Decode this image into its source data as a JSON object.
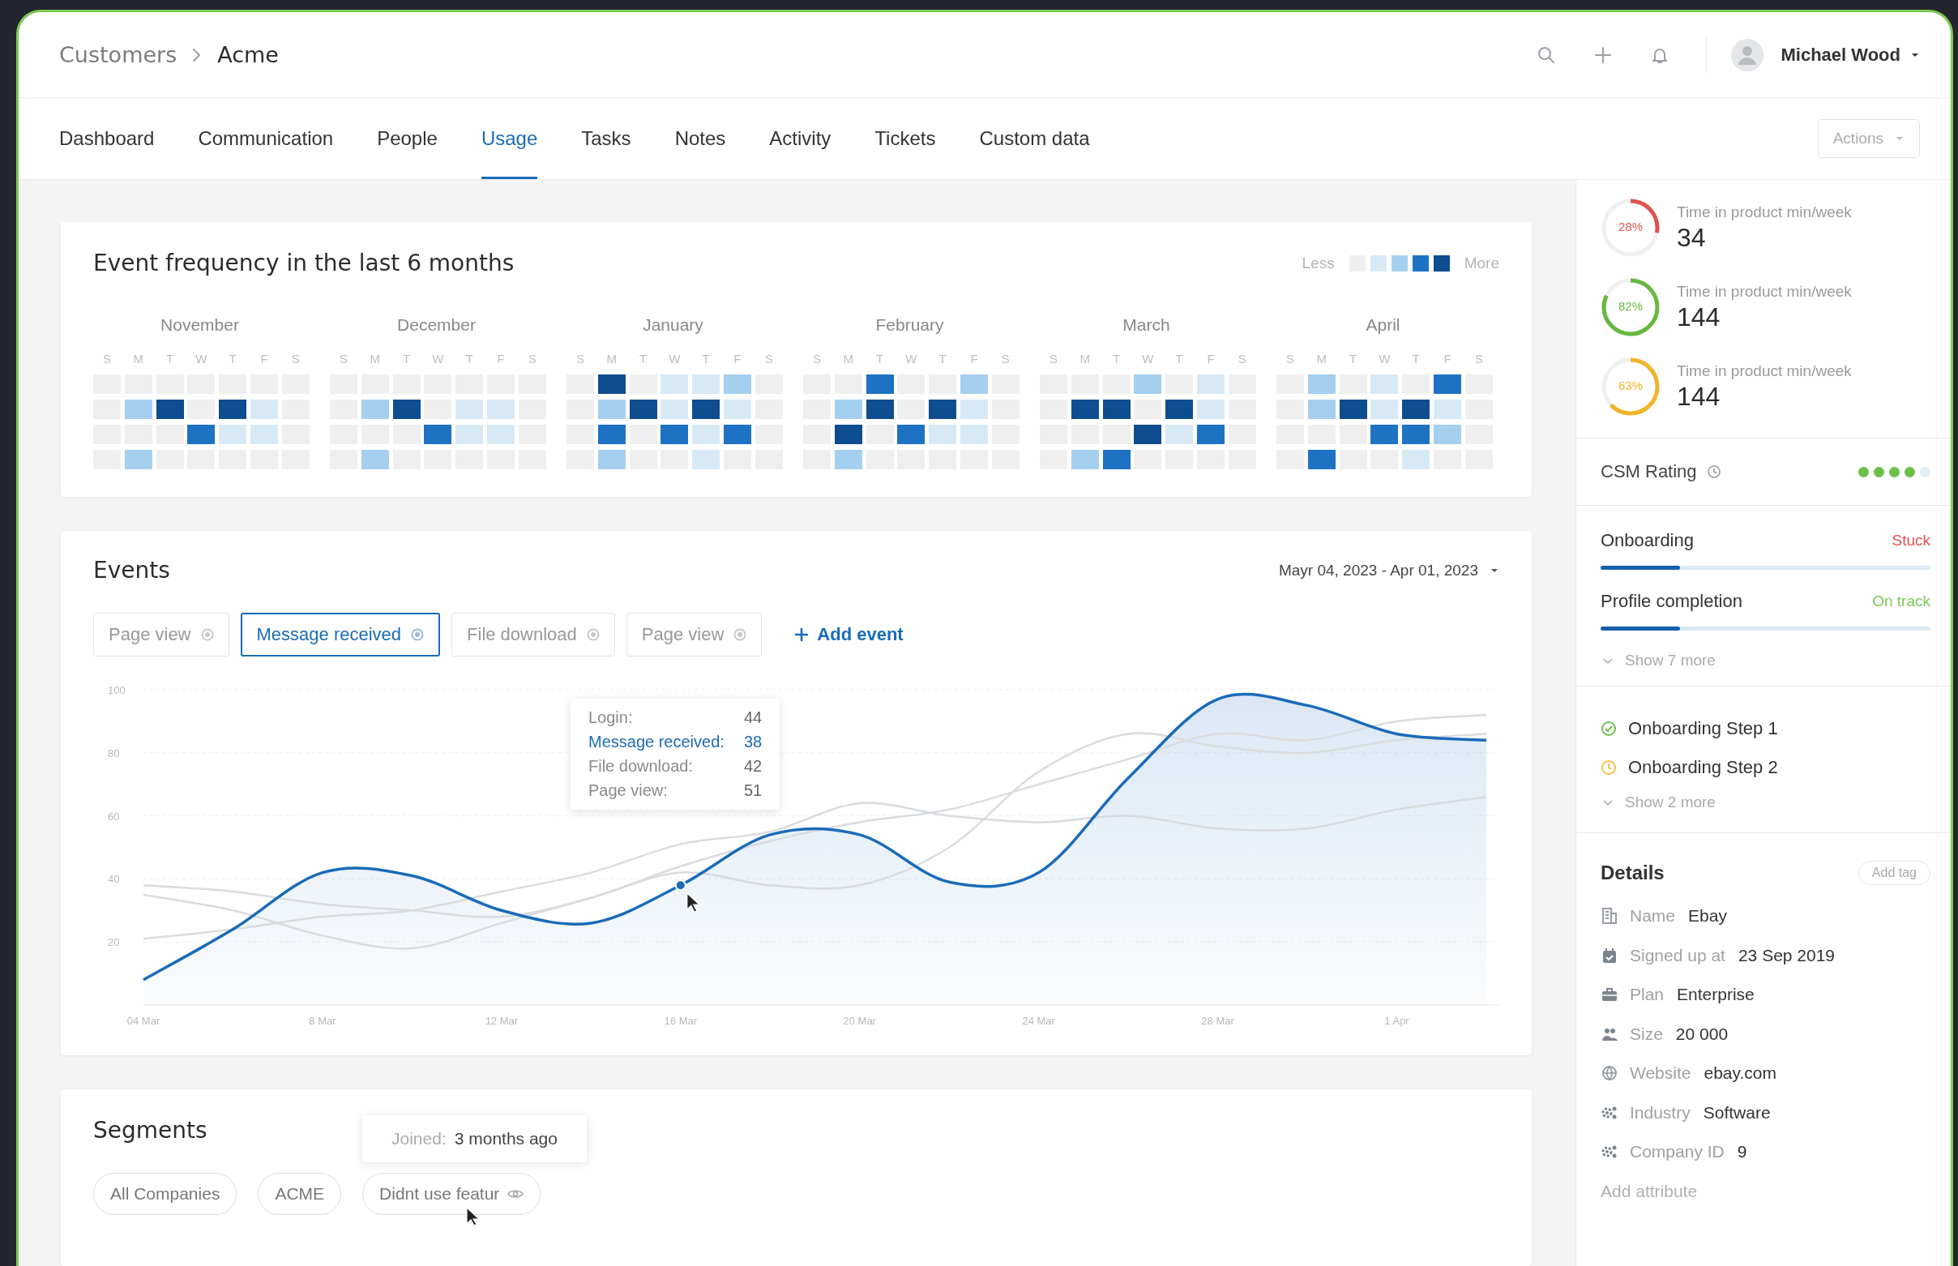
{
  "breadcrumb": [
    "Customers",
    "Acme"
  ],
  "user": {
    "name": "Michael Wood"
  },
  "tabs": [
    {
      "label": "Dashboard",
      "selected": false
    },
    {
      "label": "Communication",
      "selected": false
    },
    {
      "label": "People",
      "selected": false
    },
    {
      "label": "Usage",
      "selected": true
    },
    {
      "label": "Tasks",
      "selected": false
    },
    {
      "label": "Notes",
      "selected": false
    },
    {
      "label": "Activity",
      "selected": false
    },
    {
      "label": "Tickets",
      "selected": false
    },
    {
      "label": "Custom data",
      "selected": false
    }
  ],
  "actions_button": "Actions",
  "heatmap": {
    "title": "Event frequency in the last 6 months",
    "legend": {
      "less": "Less",
      "more": "More"
    },
    "months": [
      {
        "name": "November",
        "weekdays": [
          "S",
          "M",
          "T",
          "W",
          "T",
          "F",
          "S"
        ],
        "cells": [
          [
            {
              "color": "#efefef"
            },
            {
              "color": "#efefef"
            },
            {
              "color": "#efefef"
            },
            {
              "color": "#efefef"
            },
            {
              "color": "#efefef"
            },
            {
              "color": "#efefef"
            },
            {
              "color": "#efefef"
            }
          ],
          [
            {
              "color": "#efefef"
            },
            {
              "color": "#a5cfef"
            },
            {
              "color": "#0e4d8f"
            },
            {
              "color": "#efefef"
            },
            {
              "color": "#0e4d8f"
            },
            {
              "color": "#d8e9f6"
            },
            {
              "color": "#efefef"
            }
          ],
          [
            {
              "color": "#efefef"
            },
            {
              "color": "#efefef"
            },
            {
              "color": "#efefef"
            },
            {
              "color": "#1d72c4"
            },
            {
              "color": "#d8e9f6"
            },
            {
              "color": "#d8e9f6"
            },
            {
              "color": "#efefef"
            }
          ],
          [
            {
              "color": "#efefef"
            },
            {
              "color": "#a5cfef"
            },
            {
              "color": "#efefef"
            },
            {
              "color": "#efefef"
            },
            {
              "color": "#efefef"
            },
            {
              "color": "#efefef"
            },
            {
              "color": "#efefef"
            }
          ]
        ]
      },
      {
        "name": "December",
        "weekdays": [
          "S",
          "M",
          "T",
          "W",
          "T",
          "F",
          "S"
        ],
        "cells": [
          [
            {
              "color": "#efefef"
            },
            {
              "color": "#efefef"
            },
            {
              "color": "#efefef"
            },
            {
              "color": "#efefef"
            },
            {
              "color": "#efefef"
            },
            {
              "color": "#efefef"
            },
            {
              "color": "#efefef"
            }
          ],
          [
            {
              "color": "#efefef"
            },
            {
              "color": "#a5cfef"
            },
            {
              "color": "#0e4d8f"
            },
            {
              "color": "#efefef"
            },
            {
              "color": "#d8e9f6"
            },
            {
              "color": "#d8e9f6"
            },
            {
              "color": "#efefef"
            }
          ],
          [
            {
              "color": "#efefef"
            },
            {
              "color": "#efefef"
            },
            {
              "color": "#efefef"
            },
            {
              "color": "#1d72c4"
            },
            {
              "color": "#d8e9f6"
            },
            {
              "color": "#d8e9f6"
            },
            {
              "color": "#efefef"
            }
          ],
          [
            {
              "color": "#efefef"
            },
            {
              "color": "#a5cfef"
            },
            {
              "color": "#efefef"
            },
            {
              "color": "#efefef"
            },
            {
              "color": "#efefef"
            },
            {
              "color": "#efefef"
            },
            {
              "color": "#efefef"
            }
          ]
        ]
      },
      {
        "name": "January",
        "weekdays": [
          "S",
          "M",
          "T",
          "W",
          "T",
          "F",
          "S"
        ],
        "cells": [
          [
            {
              "color": "#efefef"
            },
            {
              "color": "#0e4d8f"
            },
            {
              "color": "#efefef"
            },
            {
              "color": "#d8e9f6"
            },
            {
              "color": "#d8e9f6"
            },
            {
              "color": "#a5cfef"
            },
            {
              "color": "#efefef"
            }
          ],
          [
            {
              "color": "#efefef"
            },
            {
              "color": "#a5cfef"
            },
            {
              "color": "#0e4d8f"
            },
            {
              "color": "#d8e9f6"
            },
            {
              "color": "#0e4d8f"
            },
            {
              "color": "#d8e9f6"
            },
            {
              "color": "#efefef"
            }
          ],
          [
            {
              "color": "#efefef"
            },
            {
              "color": "#1d72c4"
            },
            {
              "color": "#efefef"
            },
            {
              "color": "#1d72c4"
            },
            {
              "color": "#d8e9f6"
            },
            {
              "color": "#1d72c4"
            },
            {
              "color": "#efefef"
            }
          ],
          [
            {
              "color": "#efefef"
            },
            {
              "color": "#a5cfef"
            },
            {
              "color": "#efefef"
            },
            {
              "color": "#efefef"
            },
            {
              "color": "#d8e9f6"
            },
            {
              "color": "#efefef"
            },
            {
              "color": "#efefef"
            }
          ]
        ]
      },
      {
        "name": "February",
        "weekdays": [
          "S",
          "M",
          "T",
          "W",
          "T",
          "F",
          "S"
        ],
        "cells": [
          [
            {
              "color": "#efefef"
            },
            {
              "color": "#efefef"
            },
            {
              "color": "#1d72c4"
            },
            {
              "color": "#efefef"
            },
            {
              "color": "#efefef"
            },
            {
              "color": "#a5cfef"
            },
            {
              "color": "#efefef"
            }
          ],
          [
            {
              "color": "#efefef"
            },
            {
              "color": "#a5cfef"
            },
            {
              "color": "#0e4d8f"
            },
            {
              "color": "#efefef"
            },
            {
              "color": "#0e4d8f"
            },
            {
              "color": "#d8e9f6"
            },
            {
              "color": "#efefef"
            }
          ],
          [
            {
              "color": "#efefef"
            },
            {
              "color": "#0e4d8f"
            },
            {
              "color": "#efefef"
            },
            {
              "color": "#1d72c4"
            },
            {
              "color": "#d8e9f6"
            },
            {
              "color": "#d8e9f6"
            },
            {
              "color": "#efefef"
            }
          ],
          [
            {
              "color": "#efefef"
            },
            {
              "color": "#a5cfef"
            },
            {
              "color": "#efefef"
            },
            {
              "color": "#efefef"
            },
            {
              "color": "#efefef"
            },
            {
              "color": "#efefef"
            },
            {
              "color": "#efefef"
            }
          ]
        ]
      },
      {
        "name": "March",
        "weekdays": [
          "S",
          "M",
          "T",
          "W",
          "T",
          "F",
          "S"
        ],
        "cells": [
          [
            {
              "color": "#efefef"
            },
            {
              "color": "#efefef"
            },
            {
              "color": "#efefef"
            },
            {
              "color": "#a5cfef"
            },
            {
              "color": "#efefef"
            },
            {
              "color": "#d8e9f6"
            },
            {
              "color": "#efefef"
            }
          ],
          [
            {
              "color": "#efefef"
            },
            {
              "color": "#0e4d8f"
            },
            {
              "color": "#0e4d8f"
            },
            {
              "color": "#efefef"
            },
            {
              "color": "#0e4d8f"
            },
            {
              "color": "#d8e9f6"
            },
            {
              "color": "#efefef"
            }
          ],
          [
            {
              "color": "#efefef"
            },
            {
              "color": "#efefef"
            },
            {
              "color": "#efefef"
            },
            {
              "color": "#0e4d8f"
            },
            {
              "color": "#d8e9f6"
            },
            {
              "color": "#1d72c4"
            },
            {
              "color": "#efefef"
            }
          ],
          [
            {
              "color": "#efefef"
            },
            {
              "color": "#a5cfef"
            },
            {
              "color": "#1d72c4"
            },
            {
              "color": "#efefef"
            },
            {
              "color": "#efefef"
            },
            {
              "color": "#efefef"
            },
            {
              "color": "#efefef"
            }
          ]
        ]
      },
      {
        "name": "April",
        "weekdays": [
          "S",
          "M",
          "T",
          "W",
          "T",
          "F",
          "S"
        ],
        "cells": [
          [
            {
              "color": "#efefef"
            },
            {
              "color": "#a5cfef"
            },
            {
              "color": "#efefef"
            },
            {
              "color": "#d8e9f6"
            },
            {
              "color": "#efefef"
            },
            {
              "color": "#1d72c4"
            },
            {
              "color": "#efefef"
            }
          ],
          [
            {
              "color": "#efefef"
            },
            {
              "color": "#a5cfef"
            },
            {
              "color": "#0e4d8f"
            },
            {
              "color": "#d8e9f6"
            },
            {
              "color": "#0e4d8f"
            },
            {
              "color": "#d8e9f6"
            },
            {
              "color": "#efefef"
            }
          ],
          [
            {
              "color": "#efefef"
            },
            {
              "color": "#efefef"
            },
            {
              "color": "#efefef"
            },
            {
              "color": "#1d72c4"
            },
            {
              "color": "#1d72c4"
            },
            {
              "color": "#a5cfef"
            },
            {
              "color": "#efefef"
            }
          ],
          [
            {
              "color": "#efefef"
            },
            {
              "color": "#1d72c4"
            },
            {
              "color": "#efefef"
            },
            {
              "color": "#efefef"
            },
            {
              "color": "#d8e9f6"
            },
            {
              "color": "#efefef"
            },
            {
              "color": "#efefef"
            }
          ]
        ]
      }
    ]
  },
  "events": {
    "title": "Events",
    "date_range": "Mayr 04, 2023 - Apr 01, 2023",
    "filters": [
      {
        "label": "Page view",
        "selected": false
      },
      {
        "label": "Message received",
        "selected": true
      },
      {
        "label": "File download",
        "selected": false
      },
      {
        "label": "Page view",
        "selected": false
      }
    ],
    "add_event": "Add event",
    "chart_data": {
      "type": "line",
      "grid": true,
      "categories": [
        "04 Mar",
        null,
        "8 Mar",
        null,
        "12 Mar",
        null,
        "16 Mar",
        null,
        "20 Mar",
        null,
        "24 Mar",
        null,
        "28 Mar",
        null,
        "1 Apr",
        null
      ],
      "series": [
        {
          "type": "area",
          "color": "#1a6bb8",
          "values": [
            8,
            24,
            42,
            41,
            30,
            26,
            38,
            54,
            54,
            39,
            42,
            72,
            97,
            95,
            86,
            84
          ]
        },
        {
          "type": "line",
          "color": "#d9dcdf",
          "values": [
            38,
            36,
            32,
            30,
            28,
            34,
            44,
            52,
            58,
            62,
            70,
            78,
            86,
            84,
            90,
            92
          ]
        },
        {
          "type": "line",
          "color": "#d9dcdf",
          "values": [
            35,
            30,
            22,
            18,
            26,
            34,
            42,
            38,
            38,
            50,
            74,
            86,
            82,
            80,
            84,
            86
          ]
        },
        {
          "type": "line",
          "color": "#d9dcdf",
          "values": [
            21,
            24,
            28,
            30,
            36,
            42,
            51,
            55,
            64,
            60,
            58,
            60,
            56,
            56,
            62,
            66
          ]
        }
      ],
      "ylim": [
        0,
        100
      ],
      "yticks": [
        20,
        40,
        60,
        80,
        100
      ]
    },
    "tooltip": [
      {
        "label": "Login:",
        "value": "44",
        "selected": false
      },
      {
        "label": "Message received:",
        "value": "38",
        "selected": true
      },
      {
        "label": "File download:",
        "value": "42",
        "selected": false
      },
      {
        "label": "Page view:",
        "value": "51",
        "selected": false
      }
    ]
  },
  "segments": {
    "title": "Segments",
    "chips": [
      {
        "label": "All Companies",
        "kind": "plain"
      },
      {
        "label": "ACME",
        "kind": "plain"
      },
      {
        "label": "Didnt use featur",
        "kind": "watched"
      }
    ],
    "tooltip": {
      "label": "Joined:",
      "value": "3 months ago"
    }
  },
  "metrics": [
    {
      "percent": "28%",
      "level": 0.28,
      "color": "#e0524f",
      "label": "Time in product min/week",
      "value": "34"
    },
    {
      "percent": "82%",
      "level": 0.82,
      "color": "#66b83f",
      "label": "Time in product min/week",
      "value": "144"
    },
    {
      "percent": "63%",
      "level": 0.63,
      "color": "#f0b429",
      "label": "Time in product min/week",
      "value": "144"
    }
  ],
  "csm": {
    "label": "CSM Rating",
    "stars": 4
  },
  "progress": [
    {
      "label": "Onboarding",
      "status": "Stuck",
      "color": "#e0524f",
      "level": 0.24
    },
    {
      "label": "Profile completion",
      "status": "On track",
      "color": "#7cc95a",
      "level": 0.24
    }
  ],
  "progress_more": "Show 7 more",
  "steps": [
    {
      "label": "Onboarding Step 1",
      "kind": "done"
    },
    {
      "label": "Onboarding Step 2",
      "kind": "pending"
    }
  ],
  "steps_more": "Show 2 more",
  "details": {
    "title": "Details",
    "add_tag": "Add tag",
    "rows": [
      {
        "label": "Name",
        "value": "Ebay"
      },
      {
        "label": "Signed up at",
        "value": "23 Sep 2019"
      },
      {
        "label": "Plan",
        "value": "Enterprise"
      },
      {
        "label": "Size",
        "value": "20 000"
      },
      {
        "label": "Website",
        "value": "ebay.com"
      },
      {
        "label": "Industry",
        "value": "Software"
      },
      {
        "label": "Company ID",
        "value": "9"
      }
    ],
    "add_attribute": "Add attribute"
  }
}
